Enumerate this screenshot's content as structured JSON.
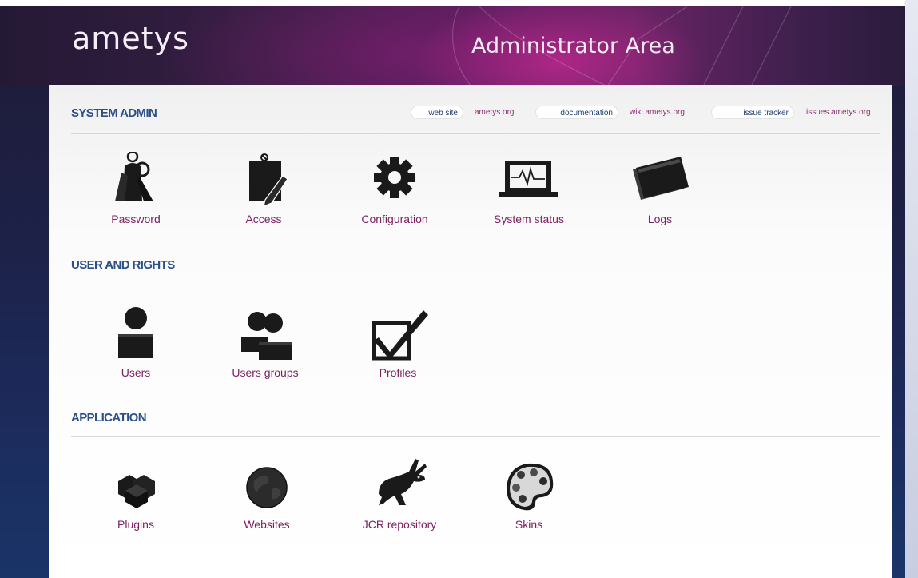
{
  "header": {
    "logo": "ametys",
    "title": "Administrator Area"
  },
  "links": [
    {
      "pill": "web site",
      "url_text": "ametys.org"
    },
    {
      "pill": "documentation",
      "url_text": "wiki.ametys.org"
    },
    {
      "pill": "issue tracker",
      "url_text": "issues.ametys.org"
    }
  ],
  "sections": {
    "system_admin": {
      "title": "SYSTEM ADMIN",
      "items": [
        {
          "label": "Password",
          "icon": "keys-icon"
        },
        {
          "label": "Access",
          "icon": "clipboard-pen-icon"
        },
        {
          "label": "Configuration",
          "icon": "gear-icon"
        },
        {
          "label": "System status",
          "icon": "monitor-pulse-icon"
        },
        {
          "label": "Logs",
          "icon": "cards-icon"
        }
      ]
    },
    "user_rights": {
      "title": "USER AND RIGHTS",
      "items": [
        {
          "label": "Users",
          "icon": "user-icon"
        },
        {
          "label": "Users groups",
          "icon": "users-group-icon"
        },
        {
          "label": "Profiles",
          "icon": "checkbox-icon"
        }
      ]
    },
    "application": {
      "title": "APPLICATION",
      "items": [
        {
          "label": "Plugins",
          "icon": "cubes-icon"
        },
        {
          "label": "Websites",
          "icon": "globe-icon"
        },
        {
          "label": "JCR repository",
          "icon": "rabbit-icon"
        },
        {
          "label": "Skins",
          "icon": "palette-icon"
        }
      ]
    }
  },
  "colors": {
    "section_title": "#2b4f86",
    "item_label": "#7b1f5d",
    "link": "#8e2f74",
    "icon": "#1a1a1a"
  }
}
